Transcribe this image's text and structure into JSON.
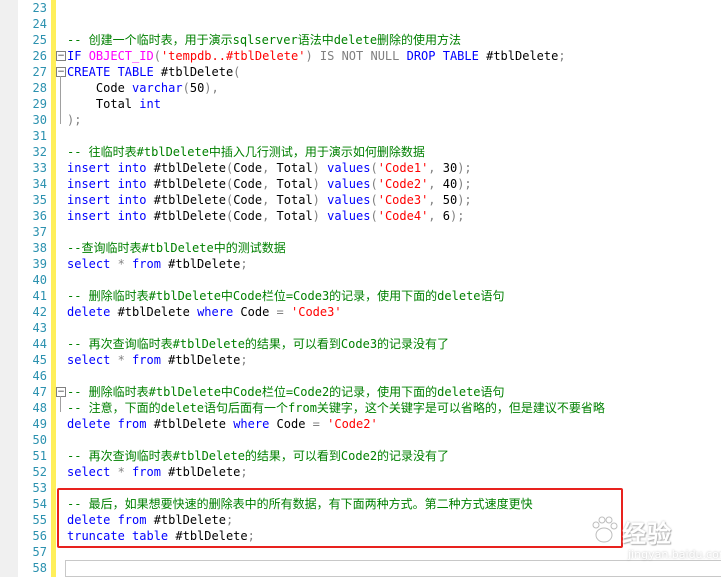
{
  "editor": {
    "lines": [
      {
        "n": "23",
        "fold": "",
        "segs": []
      },
      {
        "n": "24",
        "fold": "",
        "segs": []
      },
      {
        "n": "25",
        "fold": "",
        "segs": [
          {
            "c": "cm",
            "t": "-- 创建一个临时表，用于演示sqlserver语法中delete删除的使用方法"
          }
        ]
      },
      {
        "n": "26",
        "fold": "minus",
        "segs": [
          {
            "c": "kw",
            "t": "IF "
          },
          {
            "c": "fn",
            "t": "OBJECT_ID"
          },
          {
            "c": "gr",
            "t": "("
          },
          {
            "c": "str",
            "t": "'tempdb..#tblDelete'"
          },
          {
            "c": "gr",
            "t": ") IS NOT NULL "
          },
          {
            "c": "kw",
            "t": "DROP TABLE "
          },
          {
            "c": "tx",
            "t": "#tblDelete"
          },
          {
            "c": "gr",
            "t": ";"
          }
        ]
      },
      {
        "n": "27",
        "fold": "minus",
        "segs": [
          {
            "c": "kw",
            "t": "CREATE TABLE "
          },
          {
            "c": "tx",
            "t": "#tblDelete"
          },
          {
            "c": "gr",
            "t": "("
          }
        ]
      },
      {
        "n": "28",
        "fold": "",
        "segs": [
          {
            "c": "tx",
            "t": "    Code "
          },
          {
            "c": "kw",
            "t": "varchar"
          },
          {
            "c": "gr",
            "t": "("
          },
          {
            "c": "tx",
            "t": "50"
          },
          {
            "c": "gr",
            "t": "),"
          }
        ]
      },
      {
        "n": "29",
        "fold": "",
        "segs": [
          {
            "c": "tx",
            "t": "    Total "
          },
          {
            "c": "kw",
            "t": "int"
          }
        ]
      },
      {
        "n": "30",
        "fold": "",
        "segs": [
          {
            "c": "gr",
            "t": ");"
          }
        ]
      },
      {
        "n": "31",
        "fold": "",
        "segs": []
      },
      {
        "n": "32",
        "fold": "",
        "segs": [
          {
            "c": "cm",
            "t": "-- 往临时表#tblDelete中插入几行测试，用于演示如何删除数据"
          }
        ]
      },
      {
        "n": "33",
        "fold": "",
        "segs": [
          {
            "c": "kw",
            "t": "insert into "
          },
          {
            "c": "tx",
            "t": "#tblDelete"
          },
          {
            "c": "gr",
            "t": "("
          },
          {
            "c": "tx",
            "t": "Code"
          },
          {
            "c": "gr",
            "t": ", "
          },
          {
            "c": "tx",
            "t": "Total"
          },
          {
            "c": "gr",
            "t": ") "
          },
          {
            "c": "kw",
            "t": "values"
          },
          {
            "c": "gr",
            "t": "("
          },
          {
            "c": "str",
            "t": "'Code1'"
          },
          {
            "c": "gr",
            "t": ", "
          },
          {
            "c": "tx",
            "t": "30"
          },
          {
            "c": "gr",
            "t": ");"
          }
        ]
      },
      {
        "n": "34",
        "fold": "",
        "segs": [
          {
            "c": "kw",
            "t": "insert into "
          },
          {
            "c": "tx",
            "t": "#tblDelete"
          },
          {
            "c": "gr",
            "t": "("
          },
          {
            "c": "tx",
            "t": "Code"
          },
          {
            "c": "gr",
            "t": ", "
          },
          {
            "c": "tx",
            "t": "Total"
          },
          {
            "c": "gr",
            "t": ") "
          },
          {
            "c": "kw",
            "t": "values"
          },
          {
            "c": "gr",
            "t": "("
          },
          {
            "c": "str",
            "t": "'Code2'"
          },
          {
            "c": "gr",
            "t": ", "
          },
          {
            "c": "tx",
            "t": "40"
          },
          {
            "c": "gr",
            "t": ");"
          }
        ]
      },
      {
        "n": "35",
        "fold": "",
        "segs": [
          {
            "c": "kw",
            "t": "insert into "
          },
          {
            "c": "tx",
            "t": "#tblDelete"
          },
          {
            "c": "gr",
            "t": "("
          },
          {
            "c": "tx",
            "t": "Code"
          },
          {
            "c": "gr",
            "t": ", "
          },
          {
            "c": "tx",
            "t": "Total"
          },
          {
            "c": "gr",
            "t": ") "
          },
          {
            "c": "kw",
            "t": "values"
          },
          {
            "c": "gr",
            "t": "("
          },
          {
            "c": "str",
            "t": "'Code3'"
          },
          {
            "c": "gr",
            "t": ", "
          },
          {
            "c": "tx",
            "t": "50"
          },
          {
            "c": "gr",
            "t": ");"
          }
        ]
      },
      {
        "n": "36",
        "fold": "",
        "segs": [
          {
            "c": "kw",
            "t": "insert into "
          },
          {
            "c": "tx",
            "t": "#tblDelete"
          },
          {
            "c": "gr",
            "t": "("
          },
          {
            "c": "tx",
            "t": "Code"
          },
          {
            "c": "gr",
            "t": ", "
          },
          {
            "c": "tx",
            "t": "Total"
          },
          {
            "c": "gr",
            "t": ") "
          },
          {
            "c": "kw",
            "t": "values"
          },
          {
            "c": "gr",
            "t": "("
          },
          {
            "c": "str",
            "t": "'Code4'"
          },
          {
            "c": "gr",
            "t": ", "
          },
          {
            "c": "tx",
            "t": "6"
          },
          {
            "c": "gr",
            "t": ");"
          }
        ]
      },
      {
        "n": "37",
        "fold": "",
        "segs": []
      },
      {
        "n": "38",
        "fold": "",
        "segs": [
          {
            "c": "cm",
            "t": "--查询临时表#tblDelete中的测试数据"
          }
        ]
      },
      {
        "n": "39",
        "fold": "",
        "segs": [
          {
            "c": "kw",
            "t": "select "
          },
          {
            "c": "gr",
            "t": "* "
          },
          {
            "c": "kw",
            "t": "from "
          },
          {
            "c": "tx",
            "t": "#tblDelete"
          },
          {
            "c": "gr",
            "t": ";"
          }
        ]
      },
      {
        "n": "40",
        "fold": "",
        "segs": []
      },
      {
        "n": "41",
        "fold": "",
        "segs": [
          {
            "c": "cm",
            "t": "-- 删除临时表#tblDelete中Code栏位=Code3的记录，使用下面的delete语句"
          }
        ]
      },
      {
        "n": "42",
        "fold": "",
        "segs": [
          {
            "c": "kw",
            "t": "delete "
          },
          {
            "c": "tx",
            "t": "#tblDelete "
          },
          {
            "c": "kw",
            "t": "where "
          },
          {
            "c": "tx",
            "t": "Code "
          },
          {
            "c": "gr",
            "t": "= "
          },
          {
            "c": "str",
            "t": "'Code3'"
          }
        ]
      },
      {
        "n": "43",
        "fold": "",
        "segs": []
      },
      {
        "n": "44",
        "fold": "",
        "segs": [
          {
            "c": "cm",
            "t": "-- 再次查询临时表#tblDelete的结果，可以看到Code3的记录没有了"
          }
        ]
      },
      {
        "n": "45",
        "fold": "",
        "segs": [
          {
            "c": "kw",
            "t": "select "
          },
          {
            "c": "gr",
            "t": "* "
          },
          {
            "c": "kw",
            "t": "from "
          },
          {
            "c": "tx",
            "t": "#tblDelete"
          },
          {
            "c": "gr",
            "t": ";"
          }
        ]
      },
      {
        "n": "46",
        "fold": "",
        "segs": []
      },
      {
        "n": "47",
        "fold": "minus",
        "segs": [
          {
            "c": "cm",
            "t": "-- 删除临时表#tblDelete中Code栏位=Code2的记录，使用下面的delete语句"
          }
        ]
      },
      {
        "n": "48",
        "fold": "",
        "segs": [
          {
            "c": "cm",
            "t": "-- 注意，下面的delete语句后面有一个from关键字，这个关键字是可以省略的，但是建议不要省略"
          }
        ]
      },
      {
        "n": "49",
        "fold": "",
        "segs": [
          {
            "c": "kw",
            "t": "delete from "
          },
          {
            "c": "tx",
            "t": "#tblDelete "
          },
          {
            "c": "kw",
            "t": "where "
          },
          {
            "c": "tx",
            "t": "Code "
          },
          {
            "c": "gr",
            "t": "= "
          },
          {
            "c": "str",
            "t": "'Code2'"
          }
        ]
      },
      {
        "n": "50",
        "fold": "",
        "segs": []
      },
      {
        "n": "51",
        "fold": "",
        "segs": [
          {
            "c": "cm",
            "t": "-- 再次查询临时表#tblDelete的结果，可以看到Code2的记录没有了"
          }
        ]
      },
      {
        "n": "52",
        "fold": "",
        "segs": [
          {
            "c": "kw",
            "t": "select "
          },
          {
            "c": "gr",
            "t": "* "
          },
          {
            "c": "kw",
            "t": "from "
          },
          {
            "c": "tx",
            "t": "#tblDelete"
          },
          {
            "c": "gr",
            "t": ";"
          }
        ]
      },
      {
        "n": "53",
        "fold": "",
        "segs": []
      },
      {
        "n": "54",
        "fold": "",
        "segs": [
          {
            "c": "cm",
            "t": "-- 最后，如果想要快速的删除表中的所有数据，有下面两种方式。第二种方式速度更快"
          }
        ]
      },
      {
        "n": "55",
        "fold": "",
        "segs": [
          {
            "c": "kw",
            "t": "delete from "
          },
          {
            "c": "tx",
            "t": "#tblDelete"
          },
          {
            "c": "gr",
            "t": ";"
          }
        ]
      },
      {
        "n": "56",
        "fold": "",
        "segs": [
          {
            "c": "kw",
            "t": "truncate table "
          },
          {
            "c": "tx",
            "t": "#tblDelete"
          },
          {
            "c": "gr",
            "t": ";"
          }
        ]
      },
      {
        "n": "57",
        "fold": "",
        "segs": []
      },
      {
        "n": "58",
        "fold": "",
        "segs": []
      }
    ]
  },
  "watermark": {
    "logo_icon": "baidu-paw-icon",
    "brand": "经验",
    "url": "jingyan.baidu.com"
  },
  "colors": {
    "keyword": "#0000ff",
    "function": "#ff00ff",
    "string": "#ff0000",
    "comment": "#008000",
    "operator": "#808080",
    "line_number": "#2b91af",
    "highlight_box": "#e8221e",
    "change_bar": "#ffef5a"
  }
}
